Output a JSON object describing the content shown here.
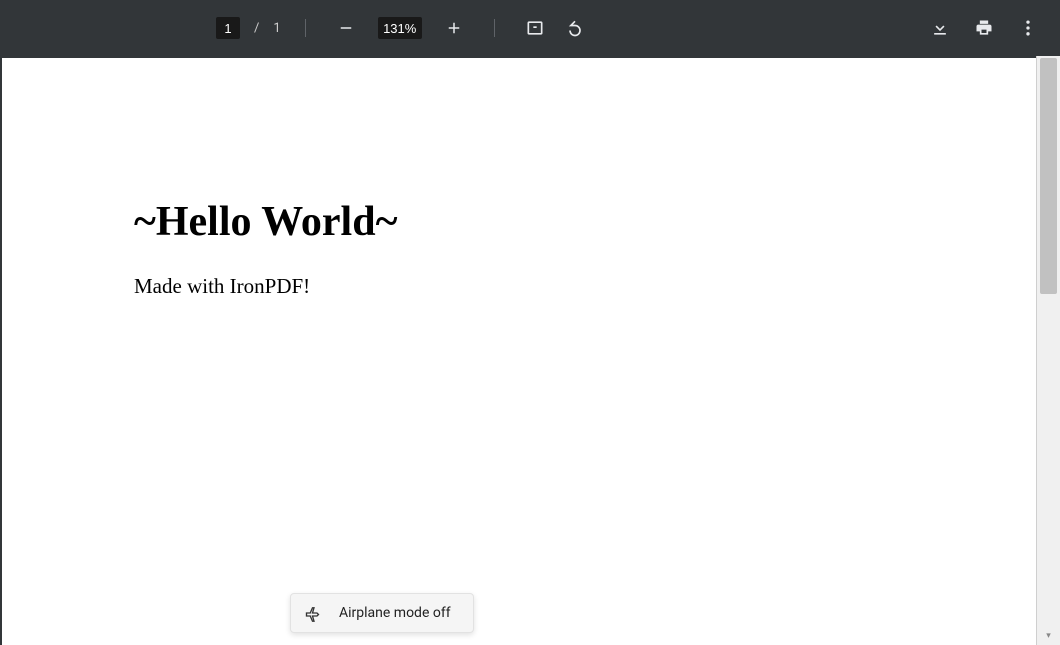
{
  "toolbar": {
    "current_page": "1",
    "page_separator": "/",
    "total_pages": "1",
    "zoom_level": "131%"
  },
  "document": {
    "heading": "~Hello World~",
    "body": "Made with IronPDF!"
  },
  "toast": {
    "message": "Airplane mode off"
  }
}
